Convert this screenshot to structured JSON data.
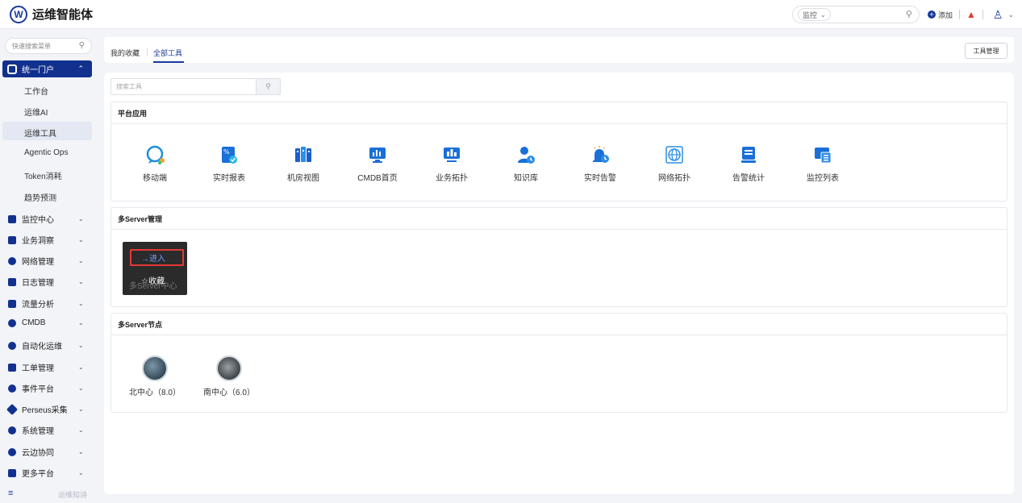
{
  "header": {
    "logo_letter": "W",
    "title": "运维智能体",
    "search_scope": "监控",
    "add_label": "添加"
  },
  "sidebar": {
    "search_placeholder": "快速搜索菜单",
    "active_group": "统一门户",
    "sub_items": [
      "工作台",
      "运维AI",
      "运维工具",
      "Agentic Ops",
      "Token消耗",
      "趋势预测"
    ],
    "menu_items": [
      "监控中心",
      "业务洞察",
      "网络管理",
      "日志管理",
      "流量分析",
      "CMDB",
      "自动化运维",
      "工单管理",
      "事件平台",
      "Perseus采集",
      "系统管理",
      "云边协同",
      "更多平台"
    ],
    "footer_label": "运维知诗"
  },
  "tabs": {
    "favorites": "我的收藏",
    "all_tools": "全部工具",
    "manage_button": "工具管理"
  },
  "tool_search": {
    "placeholder": "搜索工具"
  },
  "sections": {
    "platform": {
      "title": "平台应用",
      "apps": [
        "移动端",
        "实时报表",
        "机房视图",
        "CMDB首页",
        "业务拓扑",
        "知识库",
        "实时告警",
        "网络拓扑",
        "告警统计",
        "监控列表"
      ]
    },
    "multi_server": {
      "title": "多Server管理",
      "tile_label": "多Server中心",
      "enter_label": "→进入",
      "favorite_label": "☆收藏"
    },
    "nodes": {
      "title": "多Server节点",
      "items": [
        "北中心（8.0）",
        "南中心（6.0）"
      ]
    }
  },
  "colors": {
    "primary": "#12318f",
    "accent": "#1a3a9c",
    "alert": "#e53935"
  }
}
